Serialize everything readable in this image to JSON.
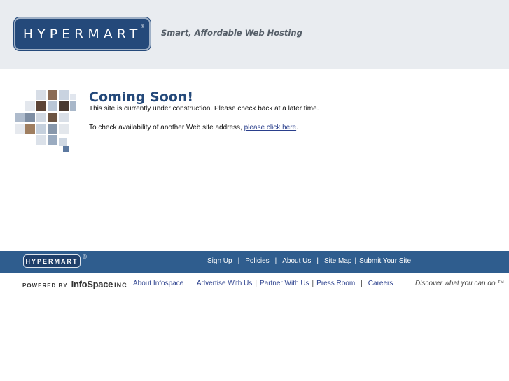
{
  "header": {
    "logo_text": "HYPERMART",
    "logo_reg": "®",
    "tagline": "Smart, Affordable Web Hosting"
  },
  "content": {
    "title": "Coming Soon!",
    "line1": "This site is currently under construction. Please check back at a later time.",
    "line2_prefix": "To check availability of another Web site address, ",
    "line2_link": "please click here",
    "line2_suffix": "."
  },
  "footer": {
    "logo_text": "HYPERMART",
    "logo_reg": "®",
    "links": [
      "Sign Up",
      "Policies",
      "About Us",
      "Site Map",
      "Submit Your Site"
    ]
  },
  "powered": {
    "prefix": "POWERED BY",
    "brand": "InfoSpace",
    "inc": "INC",
    "links": [
      "About Infospace",
      "Advertise With Us",
      "Partner With Us",
      "Press Room",
      "Careers"
    ],
    "slogan": "Discover what you can do.™"
  },
  "colors": {
    "brand_blue": "#24497a",
    "footer_blue": "#2f5d8e",
    "header_bg": "#e9ecf0"
  }
}
